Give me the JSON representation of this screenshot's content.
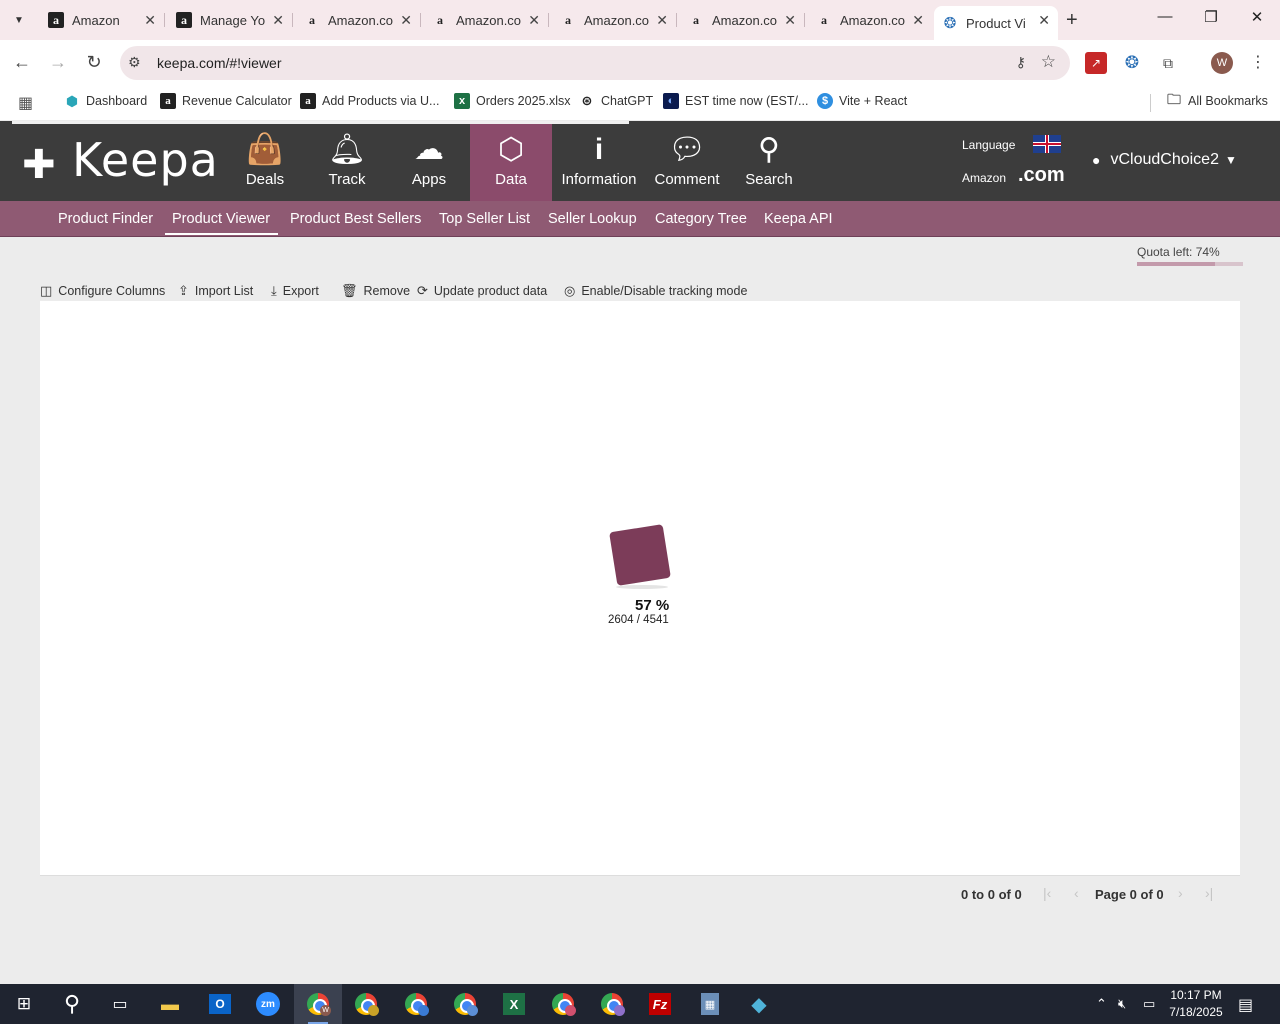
{
  "browser": {
    "tabs": [
      {
        "title": "Amazon",
        "favicon": "amazon-dark-icon",
        "active": false
      },
      {
        "title": "Manage Yo",
        "favicon": "amazon-dark-icon",
        "active": false
      },
      {
        "title": "Amazon.co",
        "favicon": "amazon-light-icon",
        "active": false
      },
      {
        "title": "Amazon.co",
        "favicon": "amazon-light-icon",
        "active": false
      },
      {
        "title": "Amazon.co",
        "favicon": "amazon-light-icon",
        "active": false
      },
      {
        "title": "Amazon.co",
        "favicon": "amazon-light-icon",
        "active": false
      },
      {
        "title": "Amazon.co",
        "favicon": "amazon-light-icon",
        "active": false
      },
      {
        "title": "Product Vi",
        "favicon": "keepa-icon",
        "active": true
      }
    ],
    "url": "keepa.com/#!viewer",
    "profile_initial": "W",
    "bookmarks": [
      {
        "label": "Dashboard",
        "icon": "hexagon-icon"
      },
      {
        "label": "Revenue Calculator",
        "icon": "amazon-icon"
      },
      {
        "label": "Add Products via U...",
        "icon": "amazon-icon"
      },
      {
        "label": "Orders 2025.xlsx",
        "icon": "excel-icon"
      },
      {
        "label": "ChatGPT",
        "icon": "chatgpt-icon"
      },
      {
        "label": "EST time now (EST/...",
        "icon": "globe-icon"
      },
      {
        "label": "Vite + React",
        "icon": "dollar-icon"
      }
    ],
    "all_bookmarks": "All Bookmarks"
  },
  "keepa": {
    "brand": "Keepa",
    "nav": [
      {
        "label": "Deals",
        "icon": "shopping-bag-icon",
        "active": false
      },
      {
        "label": "Track",
        "icon": "bell-icon",
        "active": false
      },
      {
        "label": "Apps",
        "icon": "cloud-download-icon",
        "active": false
      },
      {
        "label": "Data",
        "icon": "cube-icon",
        "active": true
      },
      {
        "label": "Information",
        "icon": "info-icon",
        "active": false
      },
      {
        "label": "Comment",
        "icon": "comment-icon",
        "active": false
      },
      {
        "label": "Search",
        "icon": "search-icon",
        "active": false
      }
    ],
    "language_label": "Language",
    "marketplace_label": "Amazon",
    "marketplace_domain": ".com",
    "username": "vCloudChoice2",
    "subnav": [
      {
        "label": "Product Finder",
        "active": false
      },
      {
        "label": "Product Viewer",
        "active": true
      },
      {
        "label": "Product Best Sellers",
        "active": false
      },
      {
        "label": "Top Seller List",
        "active": false
      },
      {
        "label": "Seller Lookup",
        "active": false
      },
      {
        "label": "Category Tree",
        "active": false
      },
      {
        "label": "Keepa API",
        "active": false
      }
    ],
    "quota_label": "Quota left: 74%",
    "quota_fraction": 0.74,
    "actions": [
      {
        "label": "Configure Columns",
        "icon": "columns-icon"
      },
      {
        "label": "Import List",
        "icon": "upload-icon"
      },
      {
        "label": "Export",
        "icon": "download-icon"
      },
      {
        "label": "Remove",
        "icon": "trash-icon"
      },
      {
        "label": "Update product data",
        "icon": "refresh-icon"
      },
      {
        "label": "Enable/Disable tracking mode",
        "icon": "eye-off-icon"
      }
    ],
    "loading": {
      "percent_text": "57 %",
      "count_text": "2604 / 4541"
    },
    "pager": {
      "range_text": "0 to 0 of 0",
      "page_text": "Page 0 of 0"
    },
    "accent_color": "#8b4b6b"
  },
  "taskbar": {
    "time": "10:17 PM",
    "date": "7/18/2025"
  }
}
